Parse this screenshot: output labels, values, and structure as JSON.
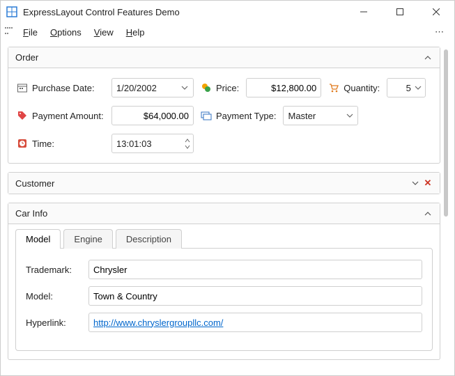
{
  "window": {
    "title": "ExpressLayout Control Features Demo"
  },
  "menu": {
    "file": "File",
    "options": "Options",
    "view": "View",
    "help": "Help"
  },
  "panels": {
    "order": {
      "title": "Order",
      "fields": {
        "purchase_date": {
          "label": "Purchase Date:",
          "value": "1/20/2002"
        },
        "price": {
          "label": "Price:",
          "value": "$12,800.00"
        },
        "quantity": {
          "label": "Quantity:",
          "value": "5"
        },
        "payment_amount": {
          "label": "Payment Amount:",
          "value": "$64,000.00"
        },
        "payment_type": {
          "label": "Payment Type:",
          "value": "Master"
        },
        "time": {
          "label": "Time:",
          "value": "13:01:03"
        }
      }
    },
    "customer": {
      "title": "Customer"
    },
    "carinfo": {
      "title": "Car Info",
      "tabs": {
        "model": "Model",
        "engine": "Engine",
        "description": "Description"
      },
      "fields": {
        "trademark": {
          "label": "Trademark:",
          "value": "Chrysler"
        },
        "model": {
          "label": "Model:",
          "value": "Town & Country"
        },
        "hyperlink": {
          "label": "Hyperlink:",
          "value": "http://www.chryslergroupllc.com/"
        }
      }
    }
  },
  "icons": {
    "calendar": "calendar-icon",
    "price": "price-tag-icon",
    "cart": "cart-icon",
    "tag": "tag-icon",
    "card": "card-icon",
    "clock": "clock-icon"
  }
}
